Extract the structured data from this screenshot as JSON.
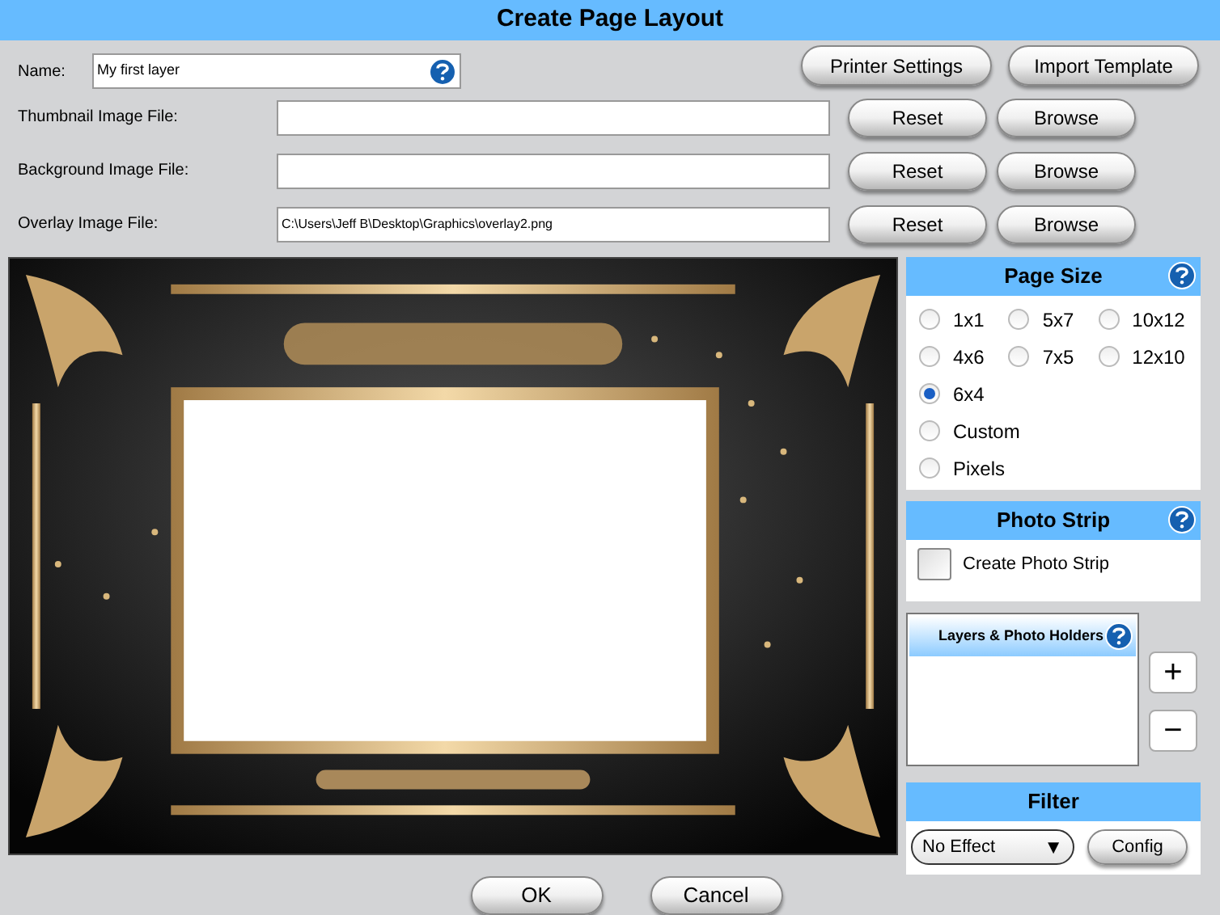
{
  "window": {
    "title": "Create Page Layout"
  },
  "name_field": {
    "label": "Name:",
    "value": "My first layer"
  },
  "top_buttons": [
    "Printer Settings",
    "Import Template"
  ],
  "file_rows": [
    {
      "label": "Thumbnail Image File:",
      "value": "",
      "reset": "Reset",
      "browse": "Browse"
    },
    {
      "label": "Background Image File:",
      "value": "",
      "reset": "Reset",
      "browse": "Browse"
    },
    {
      "label": "Overlay Image File:",
      "value": "C:\\Users\\Jeff B\\Desktop\\Graphics\\overlay2.png",
      "reset": "Reset",
      "browse": "Browse"
    }
  ],
  "preview": {
    "kind": "picture"
  },
  "page_size": {
    "title": "Page Size",
    "options": [
      {
        "label": "1x1",
        "selected": false
      },
      {
        "label": "5x7",
        "selected": false
      },
      {
        "label": "10x12",
        "selected": false
      },
      {
        "label": "4x6",
        "selected": false
      },
      {
        "label": "7x5",
        "selected": false
      },
      {
        "label": "12x10",
        "selected": false
      }
    ],
    "extra_options": [
      {
        "label": "6x4",
        "selected": true
      },
      {
        "label": "Custom",
        "selected": false
      },
      {
        "label": "Pixels",
        "selected": false
      }
    ]
  },
  "photo_strip": {
    "title": "Photo Strip",
    "checkbox": {
      "label": "Create Photo Strip",
      "checked": false
    }
  },
  "layers": {
    "title": "Layers & Photo Holders",
    "add": "+",
    "remove": "−"
  },
  "filter": {
    "title": "Filter",
    "value": "No Effect",
    "arrow": "▼",
    "config": "Config"
  },
  "footer_buttons": [
    "OK",
    "Cancel"
  ]
}
